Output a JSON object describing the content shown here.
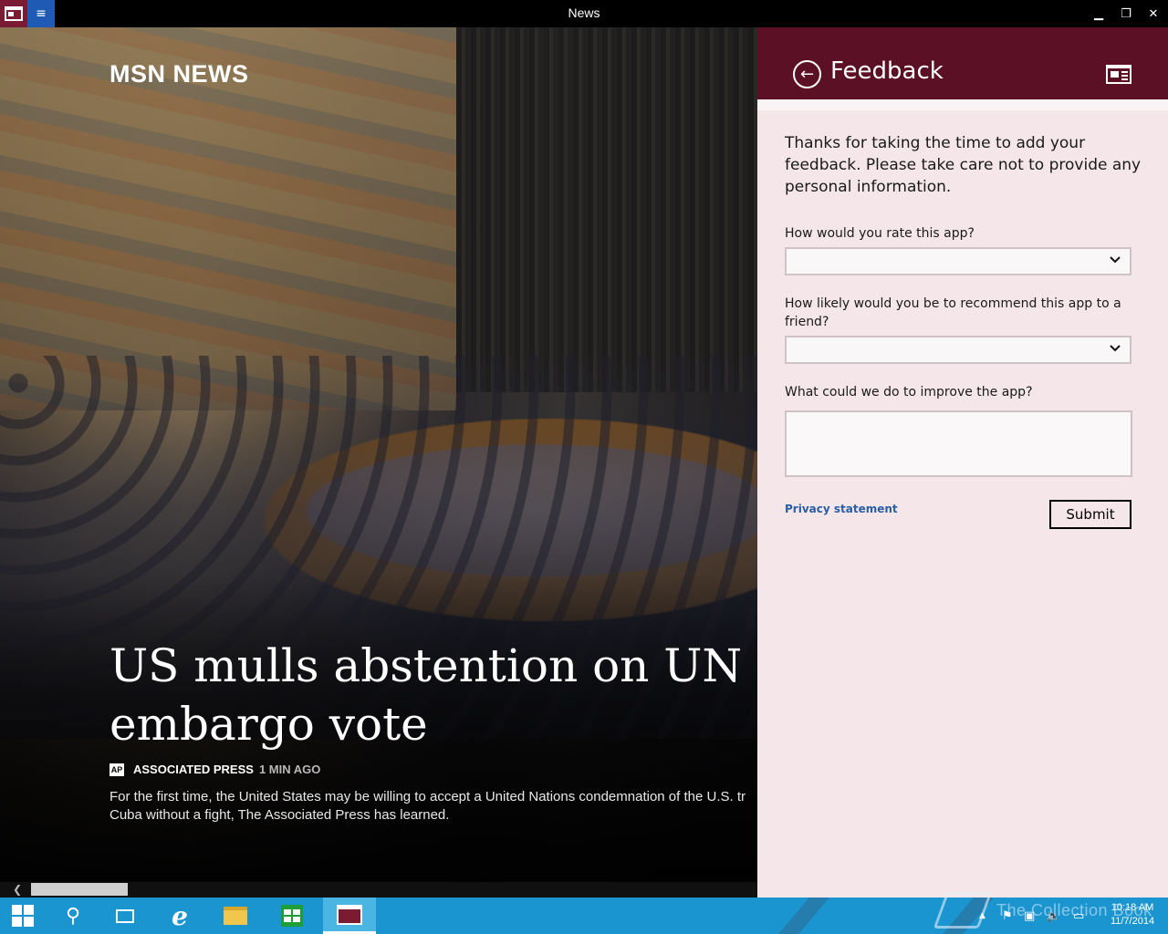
{
  "window": {
    "title": "News",
    "minimize": "▁",
    "maximize": "❐",
    "close": "✕",
    "menu_glyph": "≡"
  },
  "hero": {
    "brand": "MSN NEWS",
    "headline_line1": "US mulls abstention on UN Cu",
    "headline_line2": "embargo vote",
    "source_badge": "AP",
    "source_name": "ASSOCIATED PRESS",
    "source_time": "1 MIN AGO",
    "summary_line1": "For the first time, the United States may be willing to accept a United Nations condemnation of the U.S. tr",
    "summary_line2": "Cuba without a fight, The Associated Press has learned."
  },
  "scrollbar": {
    "left_arrow": "❮"
  },
  "feedback": {
    "title": "Feedback",
    "back_glyph": "←",
    "intro": "Thanks for taking the time to add your feedback. Please take care not to provide any personal information.",
    "q1": "How would you rate this app?",
    "q1_value": "",
    "q2": "How likely would you be to recommend this app to a friend?",
    "q2_value": "",
    "q3": "What could we do to improve the app?",
    "q3_value": "",
    "privacy": "Privacy statement",
    "submit": "Submit"
  },
  "taskbar": {
    "search_glyph": "⚲",
    "ie_glyph": "e",
    "tray_up": "▲",
    "tray_flag": "⚑",
    "tray_net": "▣",
    "tray_vol": "🔈",
    "tray_kbd": "▭",
    "time": "10:18 AM",
    "date": "11/7/2014"
  },
  "watermark": "The Collection Book",
  "colors": {
    "flyout_header": "#5b1025",
    "flyout_bg": "#f4e6e9",
    "taskbar": "#1a95d0",
    "link": "#2a5ea3"
  }
}
